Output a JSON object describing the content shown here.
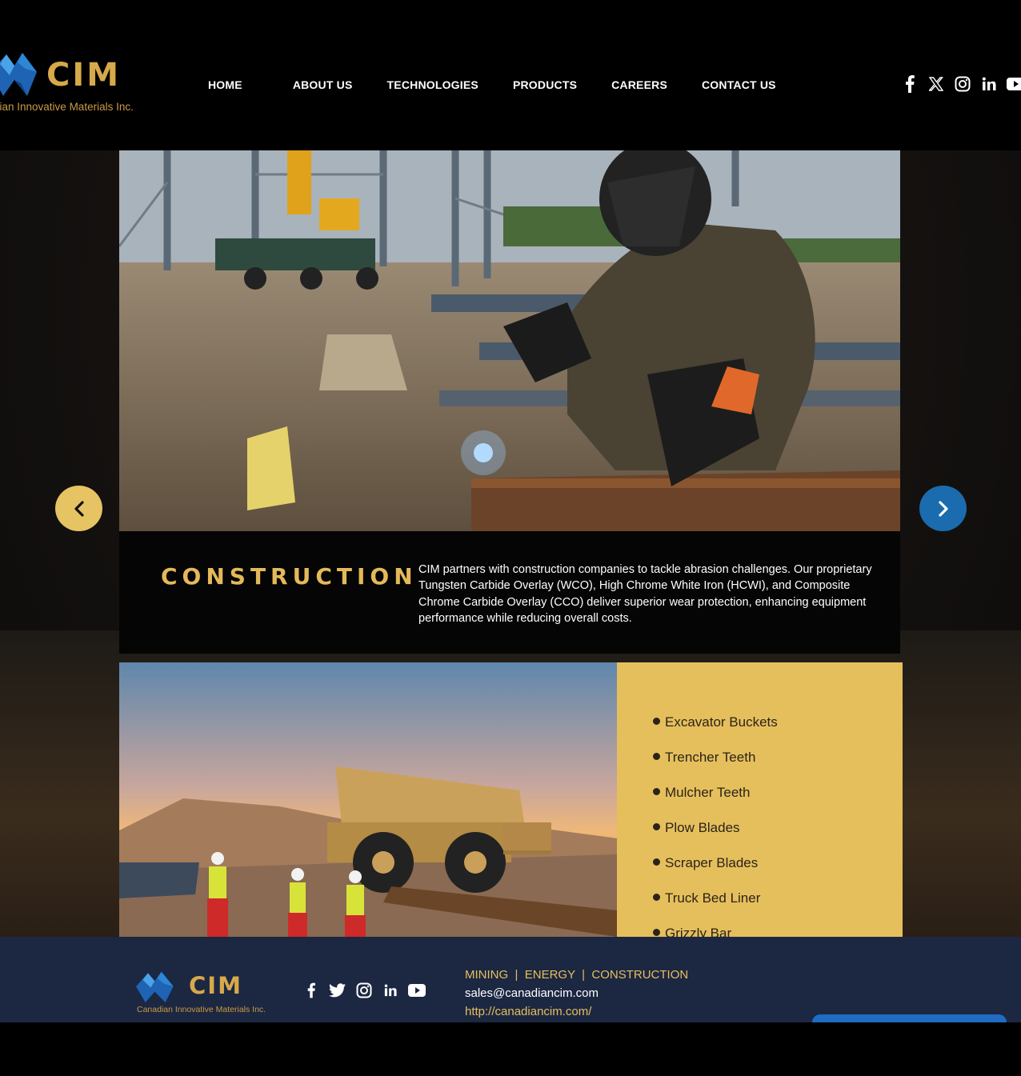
{
  "header": {
    "logo": {
      "word": "CIM",
      "subtitle": "Canadian Innovative Materials Inc.",
      "visible_subtitle": "dian Innovative Materials Inc."
    },
    "nav": [
      {
        "label": "HOME"
      },
      {
        "label": "ABOUT US"
      },
      {
        "label": "TECHNOLOGIES"
      },
      {
        "label": "PRODUCTS"
      },
      {
        "label": "CAREERS"
      },
      {
        "label": "CONTACT US"
      }
    ],
    "social_icons": [
      "facebook-icon",
      "x-icon",
      "instagram-icon",
      "linkedin-icon",
      "youtube-icon"
    ]
  },
  "slider": {
    "title": "CONSTRUCTION",
    "description": "CIM partners with construction companies to tackle abrasion challenges. Our proprietary Tungsten Carbide Overlay (WCO), High Chrome White Iron (HCWI), and Composite Chrome Carbide Overlay (CCO) deliver superior wear protection, enhancing equipment performance while reducing overall costs.",
    "prev_icon": "chevron-left-icon",
    "next_icon": "chevron-right-icon"
  },
  "products": {
    "items": [
      "Excavator Buckets",
      "Trencher Teeth",
      "Mulcher Teeth",
      "Plow Blades",
      "Scraper Blades",
      "Truck Bed Liner",
      "Grizzly Bar"
    ]
  },
  "footer": {
    "logo": {
      "word": "CIM",
      "subtitle": "Canadian Innovative Materials Inc."
    },
    "social_icons": [
      "facebook-icon",
      "twitter-icon",
      "instagram-icon",
      "linkedin-icon",
      "youtube-icon"
    ],
    "sectors": "MINING  |  ENERGY  |  CONSTRUCTION",
    "email": "sales@canadiancim.com",
    "url": "http://canadiancim.com/"
  },
  "colors": {
    "gold": "#e6bf5d",
    "navy": "#1c2742",
    "blue": "#1a6cae"
  }
}
